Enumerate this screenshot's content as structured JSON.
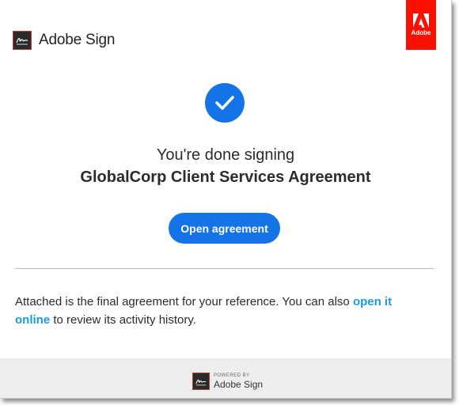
{
  "header": {
    "brand_name": "Adobe Sign",
    "logo_icon": "adobe-sign-icon",
    "corner_badge_label": "Adobe",
    "corner_badge_icon": "adobe-logo-icon",
    "corner_badge_color": "#fa0f00"
  },
  "confirmation": {
    "icon": "checkmark-icon",
    "done_text": "You're done signing",
    "document_title": "GlobalCorp Client Services Agreement",
    "open_button_label": "Open agreement"
  },
  "info": {
    "text_before": "Attached is the final agreement for your reference. You can also ",
    "link_text": "open it online",
    "text_after": " to review its activity history."
  },
  "footer": {
    "powered_by": "POWERED BY",
    "brand_name": "Adobe Sign",
    "logo_icon": "adobe-sign-icon"
  },
  "colors": {
    "accent": "#1473e6",
    "link": "#1a9ad6",
    "footer_bg": "#eeeeee"
  }
}
